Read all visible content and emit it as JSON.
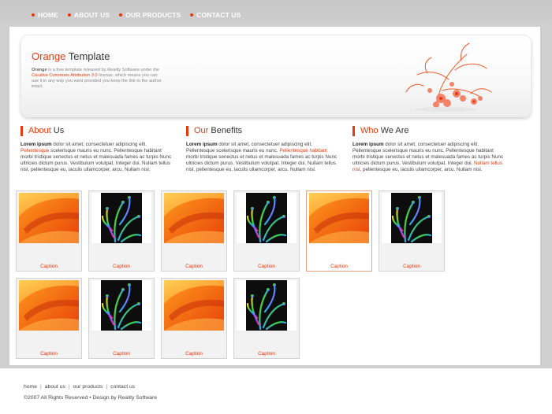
{
  "nav": {
    "items": [
      {
        "label": "HOME"
      },
      {
        "label": "ABOUT US"
      },
      {
        "label": "OUR PRODUCTS"
      },
      {
        "label": "CONTACT US"
      }
    ]
  },
  "hero": {
    "title_accent": "Orange",
    "title_rest": " Template",
    "text_bold": "Orange",
    "text_1": " is a free template released by Reality Software under the ",
    "text_link": "Creative Commons Attribution 3.0",
    "text_2": " license, which means you can use it in any way you want provided you keep the link to the author intact."
  },
  "columns": [
    {
      "head_accent": "About",
      "head_rest": " Us",
      "bold": "Lorem ipsum",
      "t1": " dolor sit amet, consectetuer adipiscing elit. ",
      "link": "Pellentesque",
      "t2": " scelerisque mauris eu nunc. Pellentesque habitant morbi tristique senectus et netus et malesuada fames ac turpis Nunc ultricies dictum purus. Vestibulum volutpat. Integer dui. Nullam tellus nisl, pellentesque eu, iaculis ullamcorper, arcu. Nullam nisl."
    },
    {
      "head_accent": "Our",
      "head_rest": " Benefits",
      "bold": "Lorem ipsum",
      "t1": " dolor sit amet, consectetuer adipiscing elit. Pellentesque scelerisque mauris eu nunc. ",
      "link": "Pellentesque habitant",
      "t2": " morbi tristique senectus et netus et malesuada fames ac turpis Nunc ultricies dictum purus. Vestibulum volutpat. Integer dui. Nullam tellus nisl, pellentesque eu, iaculis ullamcorper, arcu. Nullam nisl."
    },
    {
      "head_accent": "Who",
      "head_rest": " We Are",
      "bold": "Lorem ipsum",
      "t1": " dolor sit amet, consectetuer adipiscing elit. Pellentesque scelerisque mauris eu nunc. Pellentesque habitant morbi tristique senectus et netus et malesuada fames ac turpis Nunc ultricies dictum purus. Vestibulum volutpat. Integer dui. ",
      "link": "Nullam tellus nisl",
      "t2": ", pellentesque eu, iaculis ullamcorper, arcu. Nullam nisl."
    }
  ],
  "gallery": [
    {
      "caption": "Caption",
      "image": "orange-abstract"
    },
    {
      "caption": "Caption",
      "image": "rainbow-plant"
    },
    {
      "caption": "Caption",
      "image": "orange-abstract"
    },
    {
      "caption": "Caption",
      "image": "rainbow-plant"
    },
    {
      "caption": "Caption",
      "image": "orange-abstract",
      "active": true
    },
    {
      "caption": "Caption",
      "image": "rainbow-plant"
    },
    {
      "caption": "Caption",
      "image": "orange-abstract"
    },
    {
      "caption": "Caption",
      "image": "rainbow-plant"
    },
    {
      "caption": "Caption",
      "image": "orange-abstract"
    },
    {
      "caption": "Caption",
      "image": "rainbow-plant"
    }
  ],
  "footer": {
    "links": [
      {
        "label": "home"
      },
      {
        "label": "about us"
      },
      {
        "label": "our products"
      },
      {
        "label": "contact us"
      }
    ],
    "separator": "|",
    "copyright": "©2007 All Rights Reserved  •  Design by Reality Software"
  },
  "colors": {
    "accent": "#e8380d",
    "background": "#cfcfcf",
    "page": "#ffffff"
  }
}
